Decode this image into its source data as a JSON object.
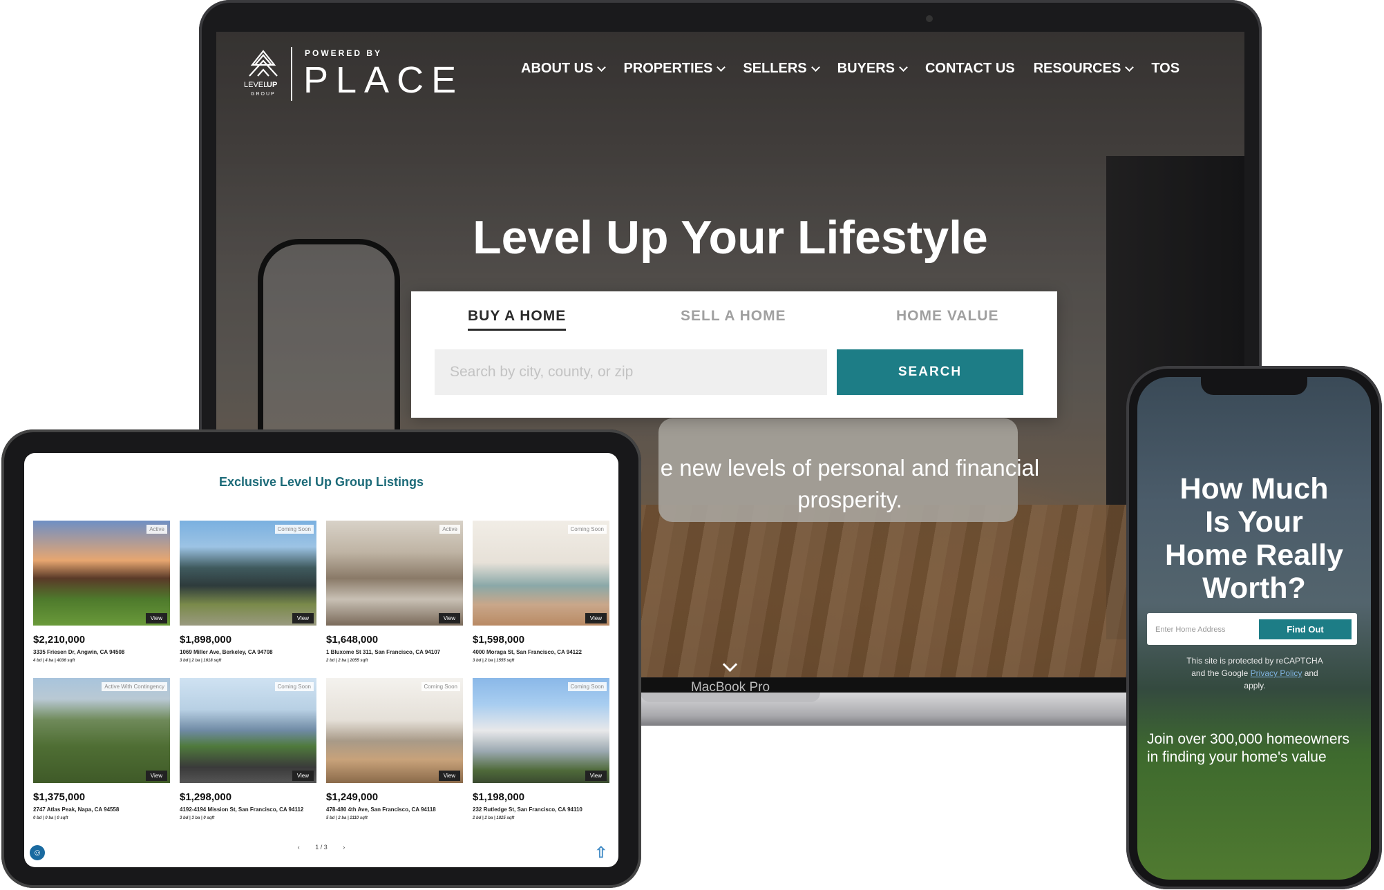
{
  "laptop": {
    "label": "MacBook Pro",
    "logo": {
      "powered_by": "POWERED BY",
      "brand": "PLACE",
      "mark_text_1": "LEVEL",
      "mark_text_2": "UP",
      "mark_text_3": "GROUP"
    },
    "nav": [
      {
        "label": "ABOUT US",
        "dropdown": true
      },
      {
        "label": "PROPERTIES",
        "dropdown": true
      },
      {
        "label": "SELLERS",
        "dropdown": true
      },
      {
        "label": "BUYERS",
        "dropdown": true
      },
      {
        "label": "CONTACT US",
        "dropdown": false
      },
      {
        "label": "RESOURCES",
        "dropdown": true
      },
      {
        "label": "TOS",
        "dropdown": false
      }
    ],
    "hero_title": "Level Up Your Lifestyle",
    "tabs": {
      "buy": "BUY A HOME",
      "sell": "SELL A HOME",
      "value": "HOME VALUE"
    },
    "search": {
      "placeholder": "Search by city, county, or zip",
      "button": "SEARCH"
    },
    "hero_subtitle_line1": "e new levels of personal and financial",
    "hero_subtitle_line2": "prosperity."
  },
  "tablet": {
    "heading": "Exclusive Level Up Group Listings",
    "view_label": "View",
    "listings": [
      {
        "price": "$2,210,000",
        "address": "3335 Friesen Dr, Angwin, CA 94508",
        "specs": "4 bd | 4 ba | 4036 sqft",
        "status": "Active"
      },
      {
        "price": "$1,898,000",
        "address": "1069 Miller Ave, Berkeley, CA 94708",
        "specs": "3 bd | 2 ba | 1618 sqft",
        "status": "Coming Soon"
      },
      {
        "price": "$1,648,000",
        "address": "1 Bluxome St 311, San Francisco, CA 94107",
        "specs": "2 bd | 2 ba | 2055 sqft",
        "status": "Active"
      },
      {
        "price": "$1,598,000",
        "address": "4000 Moraga St, San Francisco, CA 94122",
        "specs": "3 bd | 2 ba | 1555 sqft",
        "status": "Coming Soon"
      },
      {
        "price": "$1,375,000",
        "address": "2747 Atlas Peak, Napa, CA 94558",
        "specs": "0 bd | 0 ba | 0 sqft",
        "status": "Active With Contingency"
      },
      {
        "price": "$1,298,000",
        "address": "4192-4194 Mission St, San Francisco, CA 94112",
        "specs": "3 bd | 3 ba | 0 sqft",
        "status": "Coming Soon"
      },
      {
        "price": "$1,249,000",
        "address": "478-480 4th Ave, San Francisco, CA 94118",
        "specs": "5 bd | 2 ba | 2110 sqft",
        "status": "Coming Soon"
      },
      {
        "price": "$1,198,000",
        "address": "232 Rutledge St, San Francisco, CA 94110",
        "specs": "2 bd | 2 ba | 1825 sqft",
        "status": "Coming Soon"
      }
    ],
    "pager": {
      "prev": "‹",
      "page": "1 / 3",
      "next": "›"
    }
  },
  "phone": {
    "title_line1": "How Much",
    "title_line2": "Is Your",
    "title_line3": "Home Really",
    "title_line4": "Worth?",
    "address_placeholder": "Enter Home Address",
    "button": "Find Out",
    "captcha_1": "This site is protected by reCAPTCHA",
    "captcha_2": "and the Google",
    "captcha_link": "Privacy Policy",
    "captcha_3": "and",
    "captcha_4": "apply.",
    "join": "Join over 300,000 homeowners in finding your home's value"
  },
  "colors": {
    "accent": "#1d7d86",
    "heading": "#1b6a78"
  }
}
